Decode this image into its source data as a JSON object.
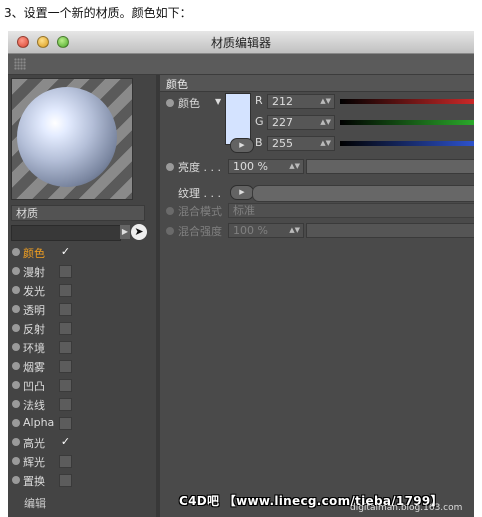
{
  "caption": "3、设置一个新的材质。颜色如下：",
  "window": {
    "title": "材质编辑器"
  },
  "material_name": "材质",
  "channels": [
    {
      "label": "颜色",
      "checked": true,
      "active": true
    },
    {
      "label": "漫射",
      "checked": false
    },
    {
      "label": "发光",
      "checked": false
    },
    {
      "label": "透明",
      "checked": false
    },
    {
      "label": "反射",
      "checked": false
    },
    {
      "label": "环境",
      "checked": false
    },
    {
      "label": "烟雾",
      "checked": false
    },
    {
      "label": "凹凸",
      "checked": false
    },
    {
      "label": "法线",
      "checked": false
    },
    {
      "label": "Alpha",
      "checked": false
    },
    {
      "label": "高光",
      "checked": true
    },
    {
      "label": "辉光",
      "checked": false
    },
    {
      "label": "置换",
      "checked": false
    }
  ],
  "edit_label": "编辑",
  "color_section": {
    "title": "颜色",
    "color_label": "颜色",
    "swatch_color": "#d4e3ff",
    "r_label": "R",
    "r_value": "212",
    "g_label": "G",
    "g_value": "227",
    "b_label": "B",
    "b_value": "255",
    "brightness_label": "亮度 . . .",
    "brightness_value": "100 %",
    "texture_label": "纹理 . . .",
    "mix_mode_label": "混合模式",
    "mix_mode_value": "标准",
    "mix_strength_label": "混合强度",
    "mix_strength_value": "100 %"
  },
  "slider_colors": {
    "r": "#d42a2a",
    "g": "#2cb02c",
    "b": "#2f56d6"
  },
  "watermark": "C4D吧 【www.linecg.com/tieba/1799】",
  "blog": "digitalman.blog.163.com",
  "checkmark": "✓"
}
